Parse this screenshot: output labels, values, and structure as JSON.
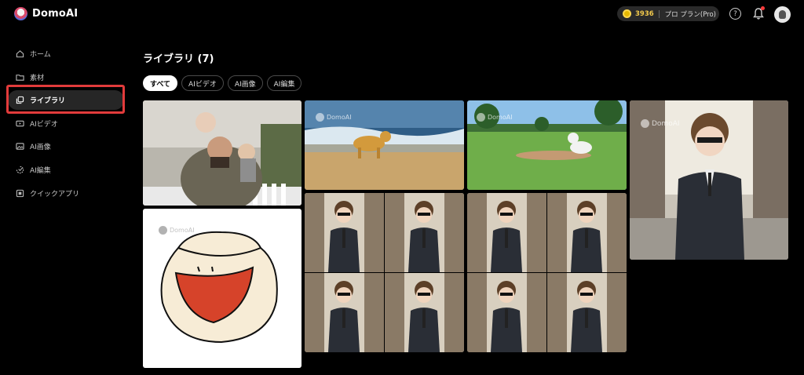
{
  "app": {
    "name": "DomoAI"
  },
  "header": {
    "credits": "3936",
    "plan": "プロ プラン(Pro)",
    "help": "?"
  },
  "sidebar": {
    "items": [
      {
        "label": "ホーム",
        "icon": "home-icon"
      },
      {
        "label": "素材",
        "icon": "folder-icon"
      },
      {
        "label": "ライブラリ",
        "icon": "library-icon",
        "active": true
      },
      {
        "label": "AIビデオ",
        "icon": "video-icon"
      },
      {
        "label": "AI画像",
        "icon": "image-icon"
      },
      {
        "label": "AI編集",
        "icon": "edit-icon"
      },
      {
        "label": "クイックアプリ",
        "icon": "apps-icon"
      }
    ]
  },
  "main": {
    "title": "ライブラリ (7)",
    "filters": [
      {
        "label": "すべて",
        "active": true
      },
      {
        "label": "AIビデオ"
      },
      {
        "label": "AI画像"
      },
      {
        "label": "AI編集"
      }
    ],
    "watermark": "DomoAI"
  },
  "colors": {
    "highlight": "#e23b3b",
    "accent": "#f2c94c",
    "background": "#000000"
  }
}
